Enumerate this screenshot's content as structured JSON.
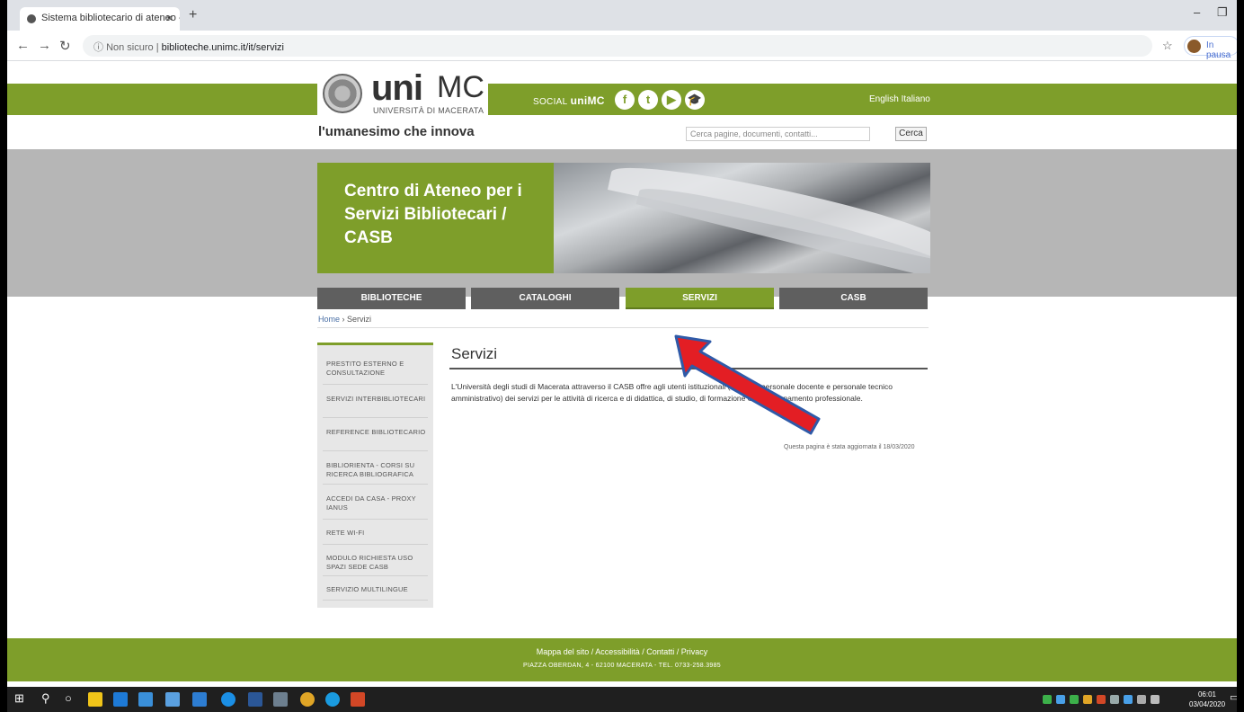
{
  "browser": {
    "tab_title": "Sistema bibliotecario di ateneo - ...",
    "tab_close": "×",
    "new_tab": "+",
    "security_label": "Non sicuro",
    "url": "biblioteche.unimc.it/it/servizi",
    "profile_label": "In pausa"
  },
  "header": {
    "logo_uni": "uni",
    "logo_mc": "MC",
    "logo_sub": "UNIVERSITÀ DI MACERATA",
    "tagline": "l'umanesimo che innova",
    "social_prefix": "SOCIAL",
    "social_brand": "uniMC",
    "languages": "English Italiano",
    "search_placeholder": "Cerca pagine, documenti, contatti...",
    "search_button": "Cerca"
  },
  "banner": {
    "title": "Centro di Ateneo per i Servizi Bibliotecari / CASB"
  },
  "nav": [
    {
      "label": "BIBLIOTECHE",
      "active": false
    },
    {
      "label": "CATALOGHI",
      "active": false
    },
    {
      "label": "SERVIZI",
      "active": true
    },
    {
      "label": "CASB",
      "active": false
    }
  ],
  "breadcrumb": {
    "home": "Home",
    "sep": "›",
    "current": "Servizi"
  },
  "sidebar": {
    "items": [
      {
        "label": "PRESTITO ESTERNO E CONSULTAZIONE"
      },
      {
        "label": "SERVIZI INTERBIBLIOTECARI"
      },
      {
        "label": "REFERENCE BIBLIOTECARIO"
      },
      {
        "label": "BIBLIORIENTA - CORSI SU RICERCA BIBLIOGRAFICA"
      },
      {
        "label": "ACCEDI DA CASA - PROXY IANUS"
      },
      {
        "label": "RETE WI-FI"
      },
      {
        "label": "MODULO RICHIESTA USO SPAZI SEDE CASB"
      },
      {
        "label": "SERVIZIO MULTILINGUE"
      }
    ]
  },
  "content": {
    "title": "Servizi",
    "text": "L'Università degli studi di Macerata attraverso il CASB offre agli utenti istituzionali (studenti, personale docente e personale tecnico amministrativo) dei servizi per le attività di ricerca e di didattica, di studio, di formazione e di aggiornamento professionale.",
    "updated": "Questa pagina è stata aggiornata il 18/03/2020"
  },
  "footer": {
    "links": "Mappa del sito / Accessibilità / Contatti / Privacy",
    "address": "PIAZZA OBERDAN, 4 - 62100 MACERATA - TEL. 0733-258.3985"
  },
  "taskbar": {
    "time": "06:01",
    "date": "03/04/2020"
  },
  "colors": {
    "brand_green": "#7e9e2a",
    "nav_grey": "#5f5f5f",
    "arrow_red": "#e31e24",
    "arrow_outline": "#2f5aa8"
  }
}
